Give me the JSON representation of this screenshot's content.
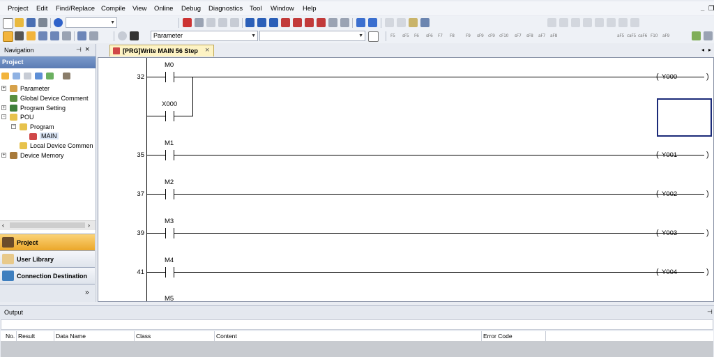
{
  "menu": [
    "Project",
    "Edit",
    "Find/Replace",
    "Compile",
    "View",
    "Online",
    "Debug",
    "Diagnostics",
    "Tool",
    "Window",
    "Help"
  ],
  "toolbar": {
    "combo_label": "Parameter"
  },
  "fkey_labels": [
    "F5",
    "sF5",
    "F6",
    "sF6",
    "F7",
    "F8",
    "F9",
    "sF9",
    "cF9",
    "cF10",
    "sF7",
    "sF8",
    "aF7",
    "aF8",
    "aF5",
    "caF5",
    "caF6",
    "F10",
    "aF9"
  ],
  "navigation": {
    "title": "Navigation",
    "pin": "&#x2BC1;",
    "close": "×",
    "section": "Project",
    "tree": [
      "Parameter",
      "Global Device Comment",
      "Program Setting",
      "POU",
      "Program",
      "MAIN",
      "Local Device Commen",
      "Device Memory"
    ],
    "buttons": [
      "Project",
      "User Library",
      "Connection Destination"
    ],
    "more": "»"
  },
  "editor": {
    "tab_label": "[PRG]Write MAIN 56 Step",
    "tab_close": "×",
    "rungs": [
      {
        "step": "32",
        "contact": "M0",
        "coil": "Y000"
      },
      {
        "step": "",
        "contact": "X000",
        "coil": ""
      },
      {
        "step": "35",
        "contact": "M1",
        "coil": "Y001"
      },
      {
        "step": "37",
        "contact": "M2",
        "coil": "Y002"
      },
      {
        "step": "39",
        "contact": "M3",
        "coil": "Y003"
      },
      {
        "step": "41",
        "contact": "M4",
        "coil": "Y004"
      },
      {
        "step": "",
        "contact": "M5",
        "coil": ""
      }
    ]
  },
  "output": {
    "title": "Output",
    "columns": [
      "No.",
      "Result",
      "Data Name",
      "Class",
      "Content",
      "Error Code"
    ]
  },
  "colors": {
    "accent": "#f2b43c",
    "selection": "#1b2a78",
    "tab": "#fdf3c4",
    "nav_section": "#5b7cb4"
  }
}
